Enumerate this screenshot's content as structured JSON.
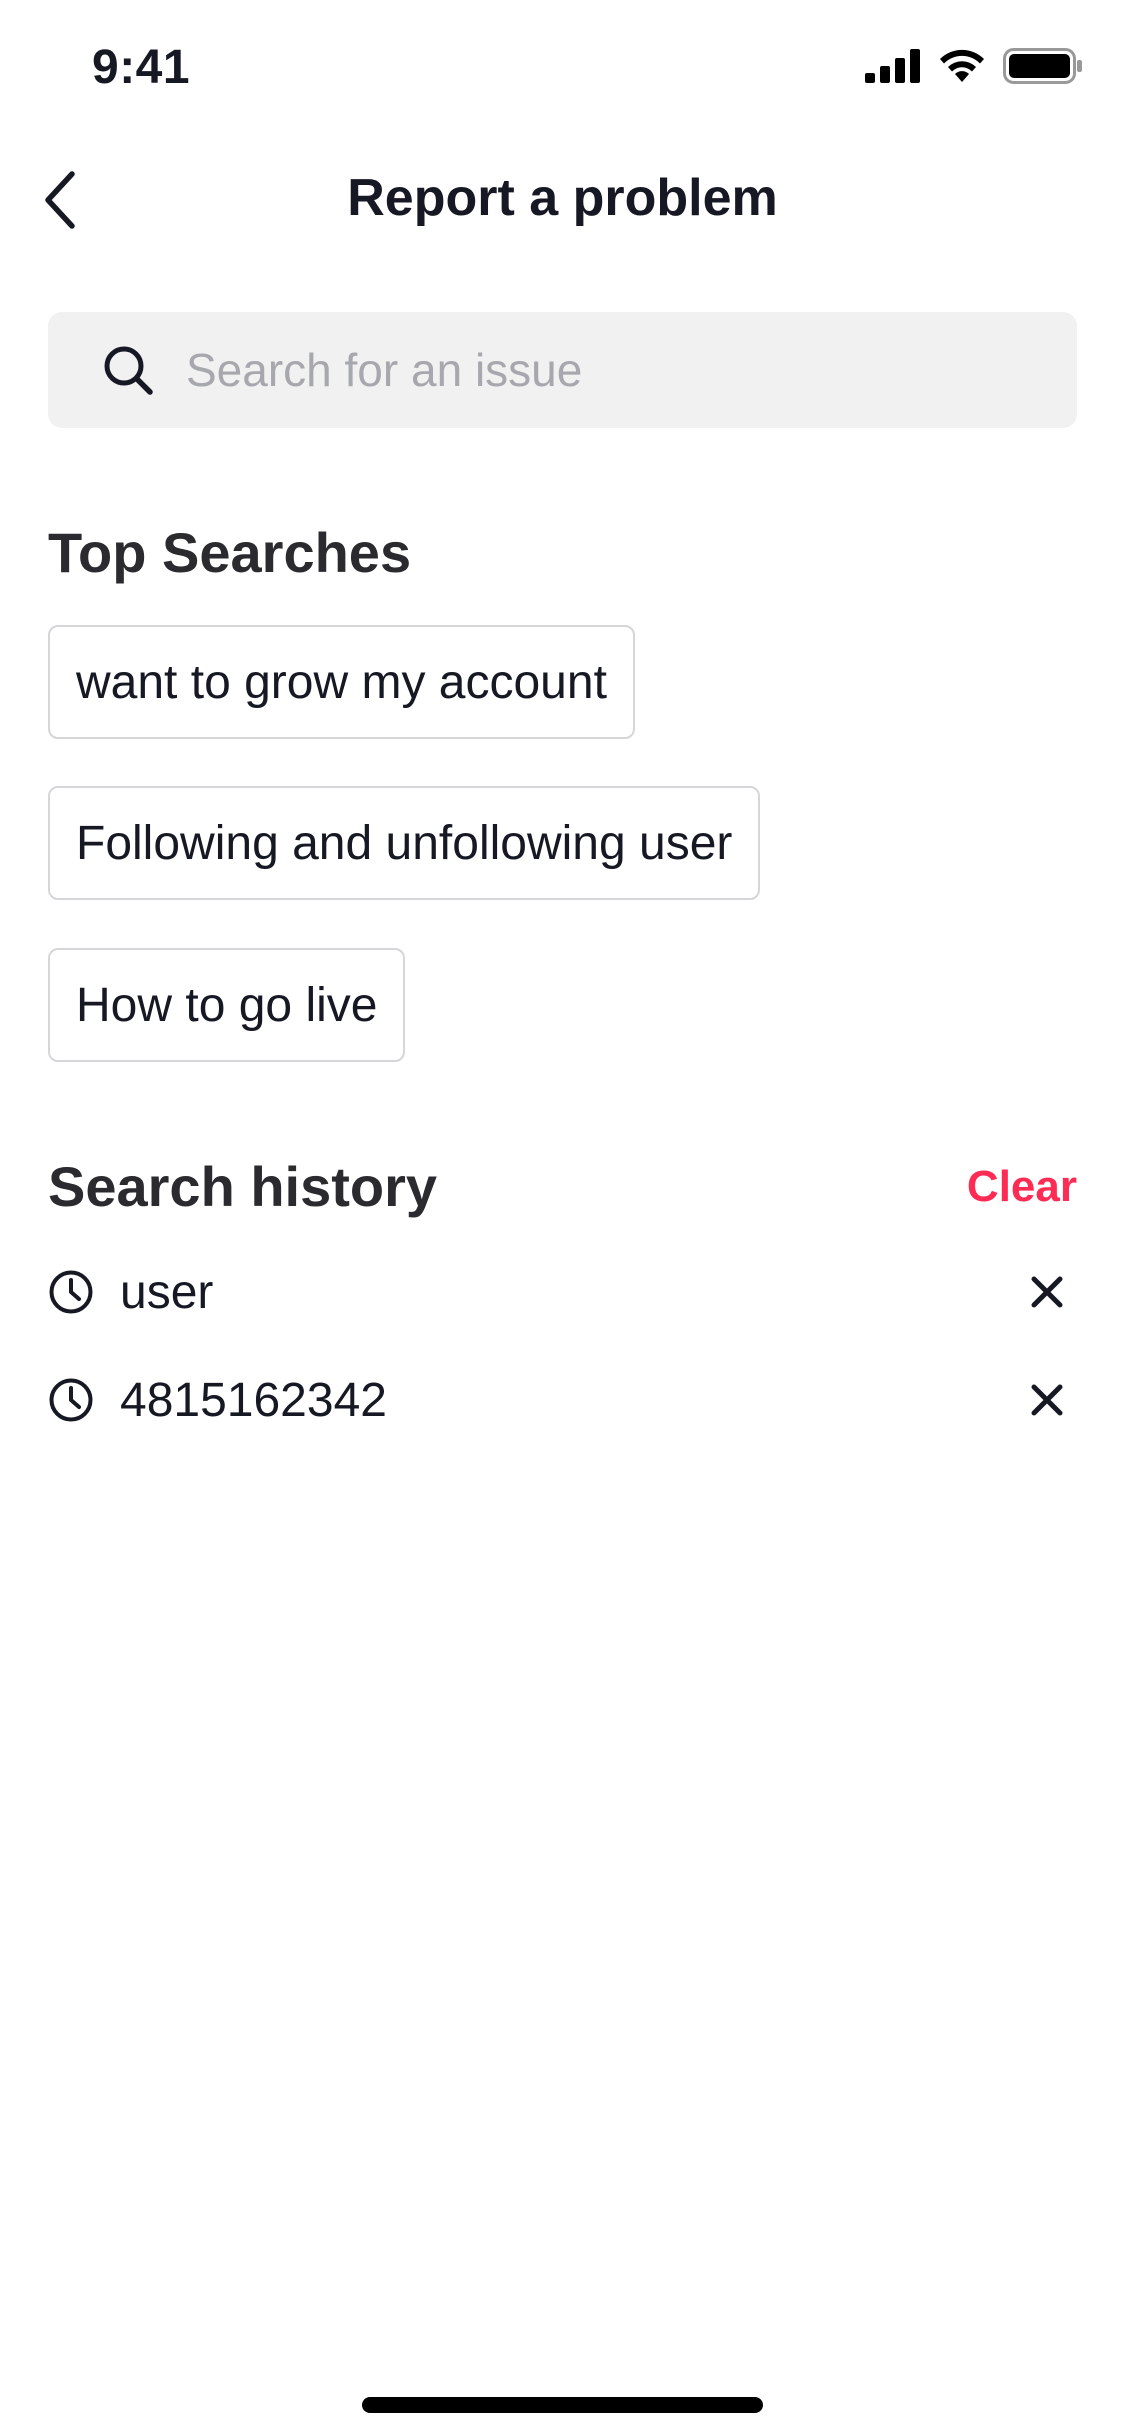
{
  "status_bar": {
    "time": "9:41",
    "icons": [
      "cellular-signal-icon",
      "wifi-icon",
      "battery-icon"
    ]
  },
  "header": {
    "back_icon": "chevron-left-icon",
    "title": "Report a problem"
  },
  "search": {
    "icon": "search-icon",
    "placeholder": "Search for an issue",
    "value": ""
  },
  "top_searches": {
    "title": "Top Searches",
    "items": [
      {
        "label": "want to grow my account"
      },
      {
        "label": "Following and unfollowing user"
      },
      {
        "label": "How to go live"
      }
    ]
  },
  "search_history": {
    "title": "Search history",
    "clear_label": "Clear",
    "items": [
      {
        "icon": "clock-icon",
        "text": "user",
        "remove_icon": "close-icon"
      },
      {
        "icon": "clock-icon",
        "text": "4815162342",
        "remove_icon": "close-icon"
      }
    ]
  },
  "colors": {
    "accent": "#fe2c55",
    "text": "#161823",
    "search_bg": "#f1f1f2",
    "chip_border": "#d6d6d9"
  }
}
